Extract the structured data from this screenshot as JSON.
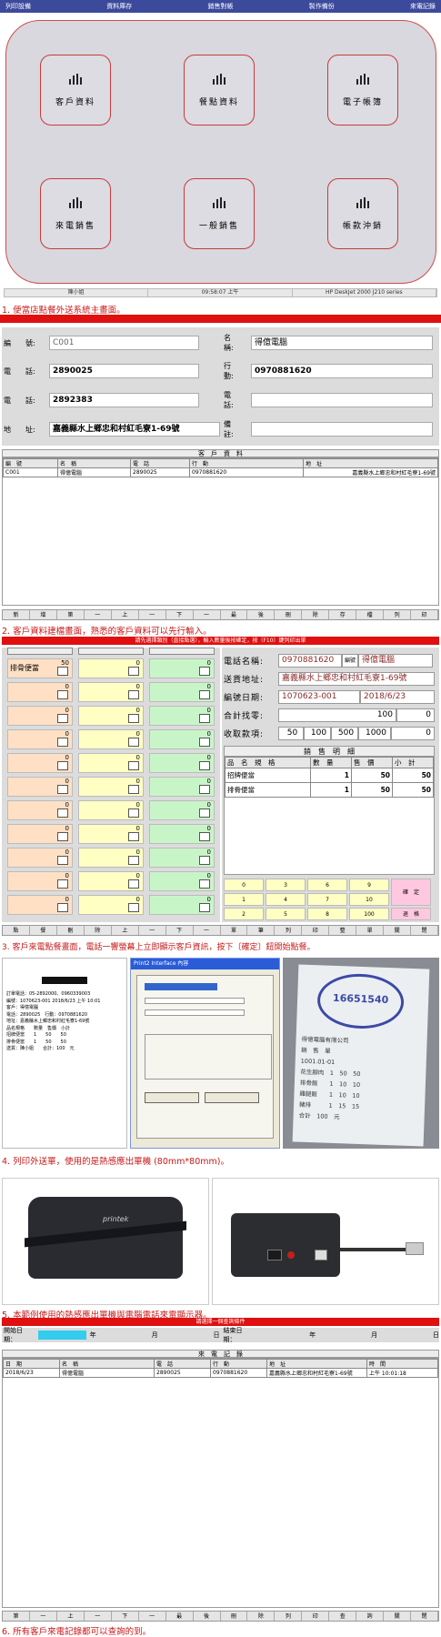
{
  "s1": {
    "menu": [
      "列印設備",
      "資料庫存",
      "銷售對帳",
      "製作備份",
      "來電記錄"
    ],
    "tiles": [
      "客戶資料",
      "餐點資料",
      "電子帳簿",
      "來電銷售",
      "一般銷售",
      "帳款沖銷"
    ],
    "status": [
      "陳小姐",
      "09:58:07 上午",
      "HP DeskJet 2000 J210 series"
    ],
    "caption": "1. 便當店點餐外送系統主畫面。"
  },
  "s2": {
    "f_code_label": "編　　號:",
    "f_code": "C001",
    "f_name_label": "名　　稱:",
    "f_name": "得億電腦",
    "f_tel1_label": "電　　話:",
    "f_tel1": "2890025",
    "f_mobile_label": "行　　動:",
    "f_mobile": "0970881620",
    "f_tel2_label": "電　　話:",
    "f_tel2": "2892383",
    "f_tel3_label": "電　　話:",
    "f_tel3": "",
    "f_addr_label": "地　　址:",
    "f_addr": "嘉義縣水上鄉忠和村紅毛寮1-69號",
    "f_note_label": "備　　註:",
    "f_note": "",
    "table_title": "客　戶　資　料",
    "headers": [
      "編　號",
      "名　稱",
      "電　話",
      "行　動",
      "地　址"
    ],
    "row": [
      "C001",
      "得億電腦",
      "2890025",
      "0970881620",
      "嘉義縣水上鄉忠和村紅毛寮1-69號"
    ],
    "nav": [
      "新",
      "增",
      "第",
      "一",
      "上",
      "一",
      "下",
      "一",
      "最",
      "後",
      "刪",
      "除",
      "存",
      "檔",
      "列",
      "印"
    ],
    "caption": "2. 客戶資料建檔畫面，熟悉的客戶資料可以先行輸入。"
  },
  "s3": {
    "top_bar": "請先選擇類別（直接點選），輸入數量後按確定，按〔F10〕鍵列印出單",
    "first_item": "排骨便當",
    "first_qty": "50",
    "zero": "0",
    "phone_label": "電話名稱:",
    "phone": "0970881620",
    "name_tag": "編號",
    "name": "得億電腦",
    "addr_label": "送貨地址:",
    "addr": "嘉義縣水上鄉忠和村紅毛寮1-69號",
    "order_label": "編號日期:",
    "order_no": "1070623-001",
    "order_date": "2018/6/23",
    "total_label": "合計找零:",
    "total": "100",
    "change": "0",
    "paid_label": "收取款項:",
    "paid": [
      "50",
      "100",
      "500",
      "1000"
    ],
    "paid_last": "0",
    "detail_title": "銷　售　明　細",
    "detail_headers": [
      "品　名　規　格",
      "數　量",
      "售　價",
      "小　計"
    ],
    "detail_rows": [
      [
        "招牌便當",
        "1",
        "50",
        "50"
      ],
      [
        "排骨便當",
        "1",
        "50",
        "50"
      ]
    ],
    "keys": [
      "0",
      "3",
      "6",
      "9",
      "確　定",
      "1",
      "4",
      "7",
      "10",
      "+",
      "2",
      "5",
      "8",
      "100",
      "退　格"
    ],
    "nav": [
      "點",
      "餐",
      "刪",
      "除",
      "上",
      "一",
      "下",
      "一",
      "單",
      "筆",
      "列",
      "印",
      "整",
      "單",
      "關",
      "閉"
    ],
    "caption": "3. 客戶來電點餐畫面，電話一響螢幕上立即顯示客戶資訊，按下〔確定〕鈕開始點餐。"
  },
  "s4": {
    "receipt_lines": [
      "訂單電話：05-2892000、0960339003",
      "編號：1070623-001 2018/6/23 上午 10:01",
      "客戶：得億電腦",
      "電話：2890025　行動：0970881620",
      "地址：嘉義縣水上鄉忠和村紅毛寮1-69號",
      "品名規格　　數量　售價　小計",
      "招牌便當　　1　　50　　50",
      "排骨便當　　1　　50　　50",
      "送貨：陳小姐　　合計：100　元"
    ],
    "dialog_title": "Print2 Interface 內容",
    "stamp_text": "16651540",
    "photo_lines": [
      "得億電腦有限公司",
      "銷　售　單",
      "1001.01-01",
      "花生腳肉　1　50　50",
      "排骨飯　　1　10　10",
      "雞腿飯　　1　10　10",
      "豬排　　　1　15　15",
      "合計　100　元"
    ],
    "caption": "4. 列印外送單，使用的是熱感應出單機 (80mm*80mm)。"
  },
  "s5": {
    "brand": "printek",
    "caption": "5. 本範例使用的熱感應出單機與電腦電話來電顯示器。"
  },
  "s6": {
    "top_bar": "請選擇一個查詢條件",
    "start_label": "開始日期：",
    "y": "年",
    "m": "月",
    "d": "日",
    "end_label": "結束日期：",
    "table_title": "來　電　記　錄",
    "headers": [
      "日　期",
      "名　稱",
      "電　話",
      "行　動",
      "地　址",
      "時　間"
    ],
    "row": [
      "2018/6/23",
      "得億電腦",
      "2890025",
      "0970881620",
      "嘉義縣水上鄉忠和村紅毛寮1-69號",
      "上午 10:01:18"
    ],
    "nav": [
      "第",
      "一",
      "上",
      "一",
      "下",
      "一",
      "最",
      "後",
      "刪",
      "除",
      "列",
      "印",
      "查",
      "詢",
      "關",
      "閉"
    ],
    "caption": "6. 所有客戶來電記錄都可以查詢的到。"
  },
  "colors": {
    "accent": "#e01010",
    "menu": "#3c4a9c",
    "tile_border": "#c83a3a",
    "orange": "#ffe0c4",
    "yellow": "#ffffc4",
    "green": "#c8f5c8"
  }
}
